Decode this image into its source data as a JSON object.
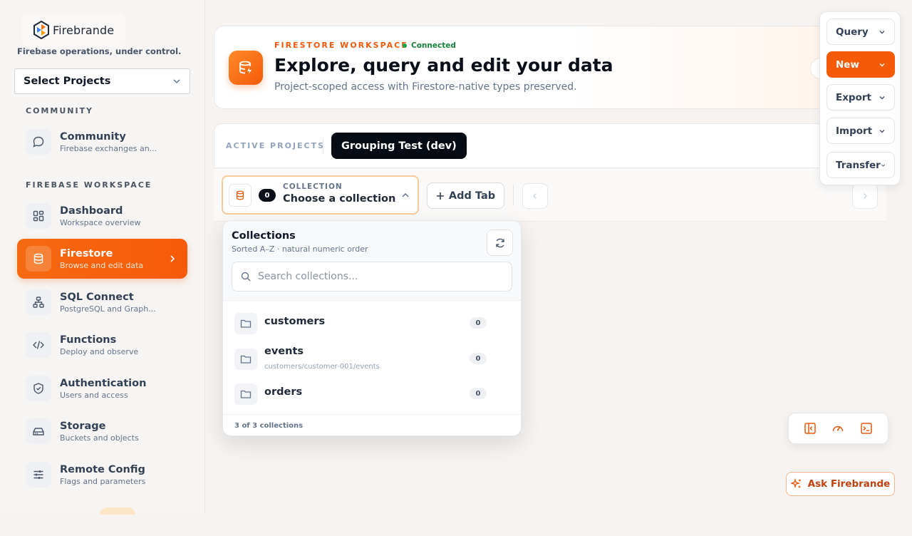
{
  "brand": {
    "name": "Firebrande",
    "tagline": "Firebase operations, under control."
  },
  "project_select": {
    "label": "Select Projects"
  },
  "sidebar": {
    "community_label": "COMMUNITY",
    "workspace_label": "FIREBASE WORKSPACE",
    "community_item": {
      "title": "Community",
      "subtitle": "Firebase exchanges an..."
    },
    "items": [
      {
        "title": "Dashboard",
        "subtitle": "Workspace overview"
      },
      {
        "title": "Firestore",
        "subtitle": "Browse and edit data"
      },
      {
        "title": "SQL Connect",
        "subtitle": "PostgreSQL and Graph..."
      },
      {
        "title": "Functions",
        "subtitle": "Deploy and observe"
      },
      {
        "title": "Authentication",
        "subtitle": "Users and access"
      },
      {
        "title": "Storage",
        "subtitle": "Buckets and objects"
      },
      {
        "title": "Remote Config",
        "subtitle": "Flags and parameters"
      }
    ]
  },
  "hero": {
    "kicker": "FIRESTORE WORKSPACE",
    "status": "Connected",
    "title": "Explore, query and edit your data",
    "subtitle": "Project-scoped access with Firestore-native types preserved."
  },
  "projects": {
    "label": "ACTIVE PROJECTS",
    "active": "Grouping Test (dev)"
  },
  "tabs": {
    "collection_badge": "0",
    "collection_label": "COLLECTION",
    "collection_value": "Choose a collection",
    "add_tab": "Add Tab"
  },
  "collections_dropdown": {
    "title": "Collections",
    "subtitle": "Sorted A–Z · natural numeric order",
    "search_placeholder": "Search collections...",
    "items": [
      {
        "name": "customers",
        "path": "",
        "count": "0"
      },
      {
        "name": "events",
        "path": "customers/customer-001/events",
        "count": "0"
      },
      {
        "name": "orders",
        "path": "",
        "count": "0"
      }
    ],
    "footer": "3 of 3 collections"
  },
  "right_menu": {
    "buttons": [
      {
        "label": "Query"
      },
      {
        "label": "New"
      },
      {
        "label": "Export"
      },
      {
        "label": "Import"
      },
      {
        "label": "Transfer"
      }
    ]
  },
  "ask": {
    "label": "Ask Firebrande"
  },
  "colors": {
    "accent": "#f55a06",
    "status_green": "#16a34a",
    "dark": "#070b14"
  }
}
